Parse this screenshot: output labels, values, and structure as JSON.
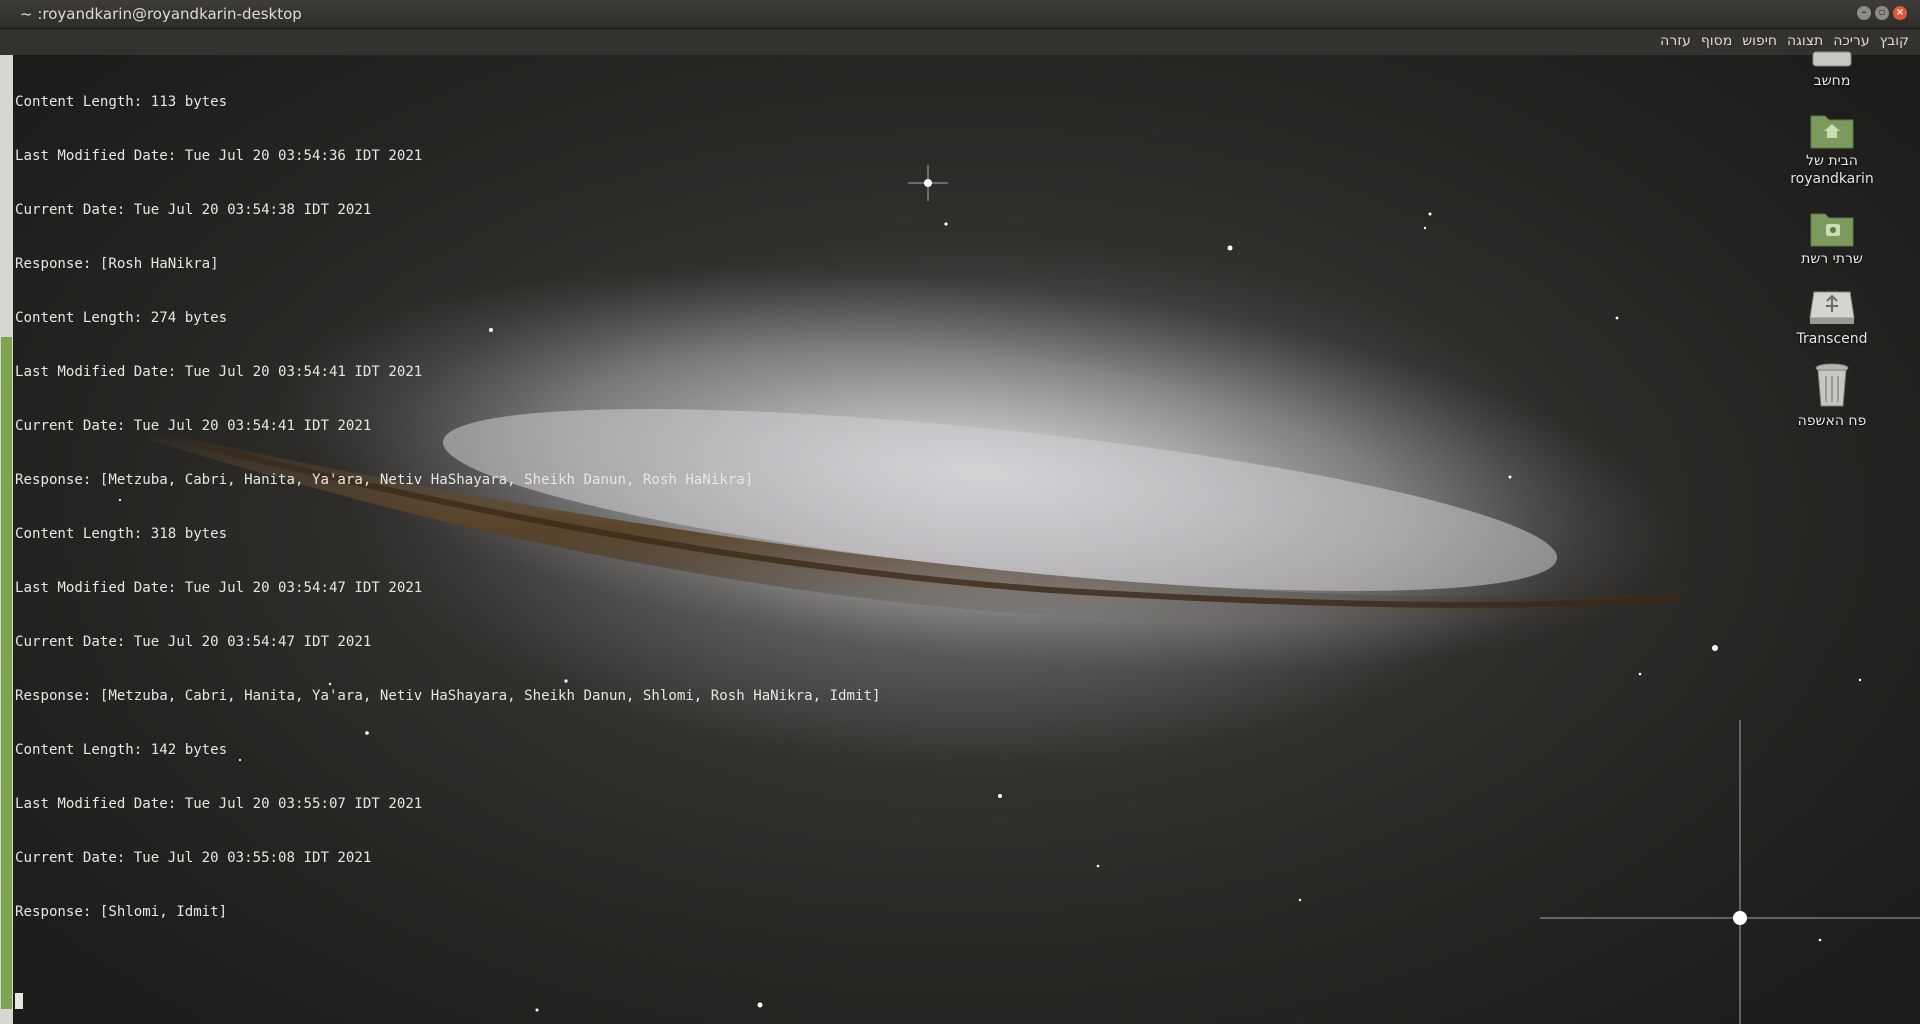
{
  "window": {
    "title": "~ :royandkarin@royandkarin-desktop",
    "buttons": {
      "minimize": "–",
      "maximize": "▫",
      "close": "×"
    }
  },
  "menu": {
    "items": [
      "קובץ",
      "עריכה",
      "תצוגה",
      "חיפוש",
      "מסוף",
      "עזרה"
    ]
  },
  "terminal": {
    "lines": [
      "Content Length: 113 bytes",
      "Last Modified Date: Tue Jul 20 03:54:36 IDT 2021",
      "Current Date: Tue Jul 20 03:54:38 IDT 2021",
      "Response: [Rosh HaNikra]",
      "Content Length: 274 bytes",
      "Last Modified Date: Tue Jul 20 03:54:41 IDT 2021",
      "Current Date: Tue Jul 20 03:54:41 IDT 2021",
      "Response: [Metzuba, Cabri, Hanita, Ya'ara, Netiv HaShayara, Sheikh Danun, Rosh HaNikra]",
      "Content Length: 318 bytes",
      "Last Modified Date: Tue Jul 20 03:54:47 IDT 2021",
      "Current Date: Tue Jul 20 03:54:47 IDT 2021",
      "Response: [Metzuba, Cabri, Hanita, Ya'ara, Netiv HaShayara, Sheikh Danun, Shlomi, Rosh HaNikra, Idmit]",
      "Content Length: 142 bytes",
      "Last Modified Date: Tue Jul 20 03:55:07 IDT 2021",
      "Current Date: Tue Jul 20 03:55:08 IDT 2021",
      "Response: [Shlomi, Idmit]"
    ],
    "scroll_position": 0.29
  },
  "desktop_icons": [
    {
      "label": "מחשב",
      "icon": "computer-icon"
    },
    {
      "label": "הבית של royandkarin",
      "icon": "home-folder-icon"
    },
    {
      "label": "שרתי רשת",
      "icon": "network-folder-icon"
    },
    {
      "label": "Transcend",
      "icon": "usb-drive-icon"
    },
    {
      "label": "פח האשפה",
      "icon": "trash-icon"
    }
  ],
  "colors": {
    "accent": "#7ea351",
    "close_button": "#e0573a",
    "terminal_text": "#e8e6e0",
    "folder": "#7c9a5c"
  }
}
